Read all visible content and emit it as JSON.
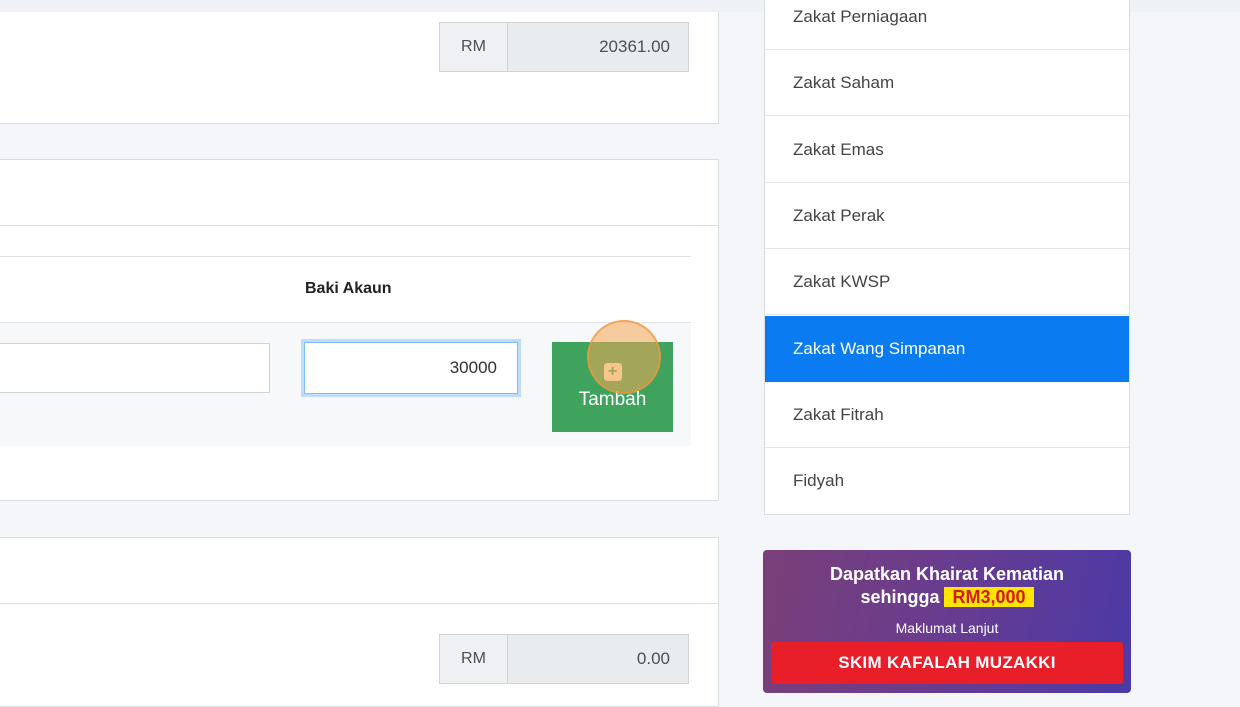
{
  "zakat_card": {
    "currency": "RM",
    "value": "20361.00"
  },
  "account_table": {
    "header_baki": "Baki Akaun",
    "baki_value": "30000",
    "add_button_label": "Tambah"
  },
  "total_card": {
    "currency": "RM",
    "value": "0.00"
  },
  "sidebar": {
    "items": [
      {
        "label": "Zakat Perniagaan"
      },
      {
        "label": "Zakat Saham"
      },
      {
        "label": "Zakat Emas"
      },
      {
        "label": "Zakat Perak"
      },
      {
        "label": "Zakat KWSP"
      },
      {
        "label": "Zakat Wang Simpanan",
        "active": true
      },
      {
        "label": "Zakat Fitrah"
      },
      {
        "label": "Fidyah"
      }
    ]
  },
  "banner": {
    "line1": "Dapatkan Khairat Kematian",
    "line2_prefix": "sehingga",
    "line2_highlight": "RM3,000",
    "line3": "Maklumat Lanjut",
    "button": "SKIM KAFALAH MUZAKKI"
  },
  "colors": {
    "active_blue": "#0a7bf0",
    "success_green": "#3fa35d",
    "banner_red": "#e81e28",
    "highlight_yellow": "#ffe500"
  }
}
